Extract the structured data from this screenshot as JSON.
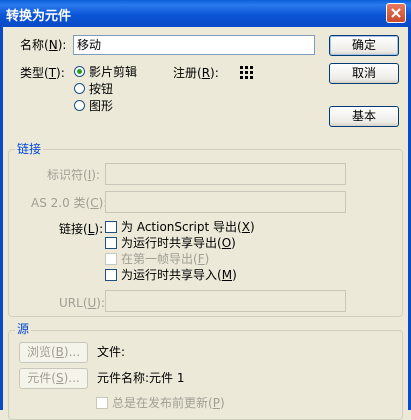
{
  "window": {
    "title": "转换为元件"
  },
  "name_field": {
    "label": "名称",
    "shortcut": "N",
    "value": "移动"
  },
  "type": {
    "label": "类型",
    "shortcut": "T",
    "options": [
      {
        "label": "影片剪辑",
        "selected": true
      },
      {
        "label": "按钮",
        "selected": false
      },
      {
        "label": "图形",
        "selected": false
      }
    ]
  },
  "registration": {
    "label": "注册",
    "shortcut": "R"
  },
  "buttons": {
    "ok": "确定",
    "cancel": "取消",
    "basic": "基本"
  },
  "linkage_group": {
    "title": "链接",
    "identifier": {
      "label": "标识符",
      "shortcut": "I",
      "value": ""
    },
    "as_class": {
      "label": "AS 2.0 类",
      "shortcut": "C",
      "value": ""
    },
    "linkage": {
      "label": "链接",
      "shortcut": "L"
    },
    "checkboxes": [
      {
        "text": "为 ActionScript 导出",
        "shortcut": "X",
        "enabled": true
      },
      {
        "text": "为运行时共享导出",
        "shortcut": "O",
        "enabled": true
      },
      {
        "text": "在第一帧导出",
        "shortcut": "F",
        "enabled": false
      },
      {
        "text": "为运行时共享导入",
        "shortcut": "M",
        "enabled": true
      }
    ],
    "url": {
      "label": "URL",
      "shortcut": "U",
      "value": ""
    }
  },
  "source_group": {
    "title": "源",
    "browse": {
      "label": "浏览",
      "shortcut": "B",
      "suffix": "..."
    },
    "file_label": "文件:",
    "symbol": {
      "label": "元件",
      "shortcut": "S",
      "suffix": "..."
    },
    "symbol_name": "元件名称:元件 1",
    "update_checkbox": {
      "text": "总是在发布前更新",
      "shortcut": "P"
    }
  }
}
